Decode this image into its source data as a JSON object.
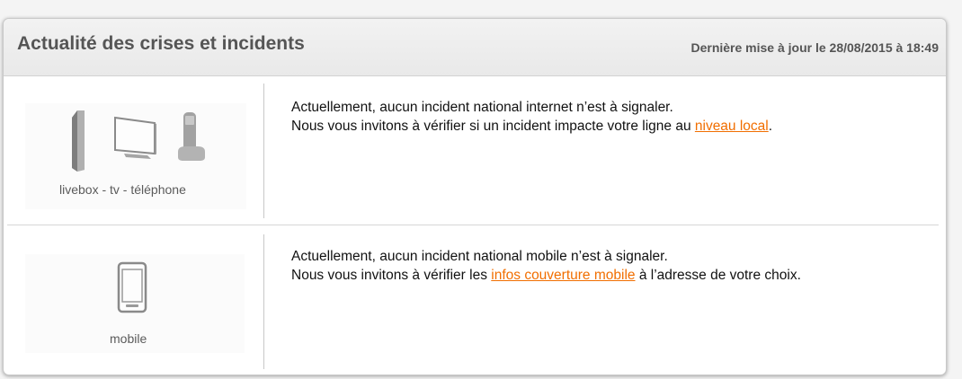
{
  "header": {
    "title": "Actualité des crises et incidents",
    "last_update": "Dernière mise à jour le 28/08/2015 à 18:49"
  },
  "rows": [
    {
      "device_label": "livebox - tv - téléphone",
      "icons": [
        "livebox-icon",
        "tv-icon",
        "phone-icon"
      ],
      "line1": "Actuellement, aucun incident national internet n’est à signaler.",
      "line2_before": "Nous vous invitons à vérifier si un incident impacte votre ligne au ",
      "link": "niveau local",
      "line2_after": "."
    },
    {
      "device_label": "mobile",
      "icons": [
        "mobile-icon"
      ],
      "line1": "Actuellement, aucun incident national mobile n’est à signaler.",
      "line2_before": "Nous vous invitons à vérifier les ",
      "link": "infos couverture mobile",
      "line2_after": " à l’adresse de votre choix."
    }
  ],
  "colors": {
    "link": "#f16e00",
    "title": "#555555",
    "icon": "#9a9a9a"
  }
}
